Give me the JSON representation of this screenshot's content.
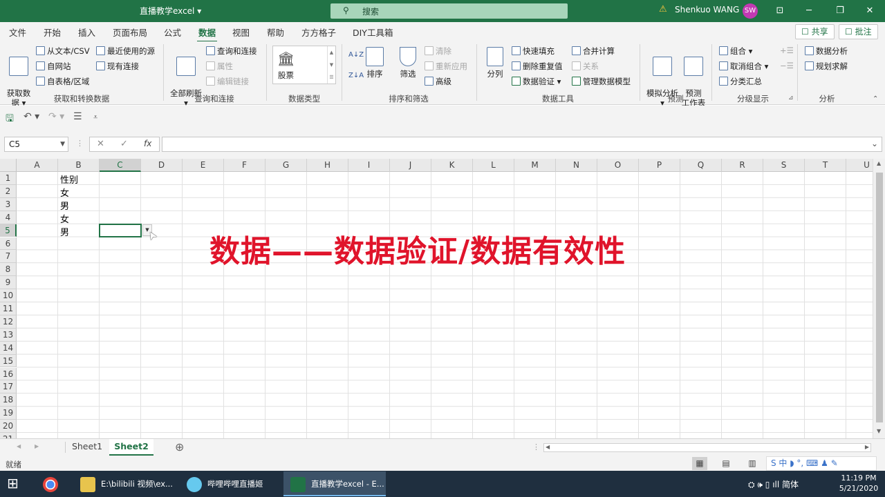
{
  "titlebar": {
    "doc_title": "直播教学excel ▾",
    "search_icon": "⚲",
    "search_placeholder": "搜索",
    "warning_icon": "⚠",
    "user_name": "Shenkuo WANG",
    "avatar_initials": "SW",
    "ribbon_display_icon": "⊡",
    "minimize_icon": "─",
    "restore_icon": "❐",
    "close_icon": "✕"
  },
  "tabs": [
    {
      "label": "文件"
    },
    {
      "label": "开始"
    },
    {
      "label": "插入"
    },
    {
      "label": "页面布局"
    },
    {
      "label": "公式"
    },
    {
      "label": "数据"
    },
    {
      "label": "视图"
    },
    {
      "label": "帮助"
    },
    {
      "label": "方方格子"
    },
    {
      "label": "DIY工具箱"
    }
  ],
  "share_label": "☐ 共享",
  "comment_label": "☐ 批注",
  "ribbon": {
    "get_data": "获取数\n据 ▾",
    "from_text_csv": "从文本/CSV",
    "from_web": "自网站",
    "from_table": "自表格/区域",
    "recent_sources": "最近使用的源",
    "existing_connections": "现有连接",
    "group_get_transform": "获取和转换数据",
    "refresh_all": "全部刷新\n▾",
    "queries_connections": "查询和连接",
    "properties": "属性",
    "edit_links": "编辑链接",
    "group_queries": "查询和连接",
    "stocks": "股票",
    "group_data_types": "数据类型",
    "sort_az": "A↓Z",
    "sort_za": "Z↓A",
    "sort": "排序",
    "filter": "筛选",
    "clear": "清除",
    "reapply": "重新应用",
    "advanced": "高级",
    "group_sort_filter": "排序和筛选",
    "text_to_columns": "分列",
    "flash_fill": "快速填充",
    "remove_duplicates": "删除重复值",
    "data_validation": "数据验证 ▾",
    "consolidate": "合并计算",
    "relationships": "关系",
    "manage_data_model": "管理数据模型",
    "group_data_tools": "数据工具",
    "what_if": "模拟分析\n▾",
    "forecast_sheet": "预测\n工作表",
    "group_forecast": "预测",
    "group_outline_btn": "组合 ▾",
    "ungroup": "取消组合 ▾",
    "subtotal": "分类汇总",
    "group_outline": "分级显示",
    "data_analysis": "数据分析",
    "solver": "规划求解",
    "group_analysis": "分析"
  },
  "qat": {
    "save_icon": "🖫",
    "undo_icon": "↶ ▾",
    "redo_icon": "↷ ▾",
    "form_icon": "☰",
    "customize_icon": "⩡"
  },
  "formula_bar": {
    "name_box": "C5",
    "cancel": "✕",
    "enter": "✓",
    "fx": "fx",
    "value": "",
    "expand": "⌄"
  },
  "grid": {
    "columns": [
      "A",
      "B",
      "C",
      "D",
      "E",
      "F",
      "G",
      "H",
      "I",
      "J",
      "K",
      "L",
      "M",
      "N",
      "O",
      "P",
      "Q",
      "R",
      "S",
      "T",
      "U"
    ],
    "rows": [
      "1",
      "2",
      "3",
      "4",
      "5",
      "6",
      "7",
      "8",
      "9",
      "10",
      "11",
      "12",
      "13",
      "14",
      "15",
      "16",
      "17",
      "18",
      "19",
      "20",
      "21"
    ],
    "cells": [
      {
        "ref": "B1",
        "value": "性别"
      },
      {
        "ref": "B2",
        "value": "女"
      },
      {
        "ref": "B3",
        "value": "男"
      },
      {
        "ref": "B4",
        "value": "女"
      },
      {
        "ref": "B5",
        "value": "男"
      }
    ],
    "selected": "C5",
    "dropdown_icon": "▼",
    "cursor_icon": "➤"
  },
  "overlay_caption": "数据——数据验证/数据有效性",
  "sheets": [
    {
      "label": "Sheet1"
    },
    {
      "label": "Sheet2",
      "active": true
    }
  ],
  "add_sheet_icon": "⊕",
  "status": {
    "ready": "就绪",
    "normal_view_icon": "▦",
    "page_layout_icon": "▤",
    "page_break_icon": "▥",
    "ime_text": "S 中 ◗ °, ⌨ ♟ ✎"
  },
  "taskbar": {
    "start_icon": "⊞",
    "items": [
      {
        "label": "",
        "icon_color": "#e8a33d"
      },
      {
        "label": "",
        "icon_color": "#e8c44d"
      },
      {
        "label": "E:\\bilibili 视频\\ex...",
        "icon_color": "#e8c44d"
      },
      {
        "label": "哔哩哔哩直播姬",
        "icon_color": "#66c9ee"
      },
      {
        "label": "直播教学excel - E...",
        "icon_color": "#217346"
      }
    ],
    "tray_text": "⛭ 🕪 ▯ ıll 简体",
    "time": "11:19 PM",
    "date": "5/21/2020"
  },
  "colors": {
    "accent": "#217346",
    "caption": "#e0142b"
  }
}
